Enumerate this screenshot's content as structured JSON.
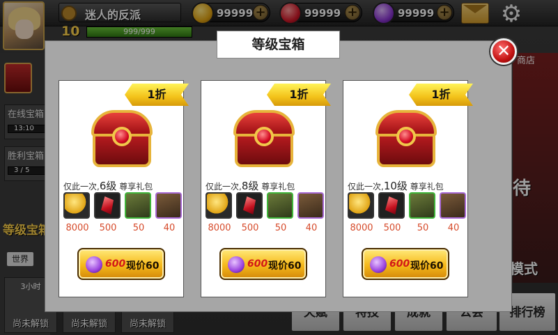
{
  "player": {
    "name": "迷人的反派",
    "level": "10",
    "exp_text": "999/999",
    "exp_fraction": 1.0
  },
  "currencies": [
    {
      "icon": "gold-coin-icon",
      "value": "99999"
    },
    {
      "icon": "ruby-gem-icon",
      "value": "99999"
    },
    {
      "icon": "purple-gem-icon",
      "value": "99999"
    }
  ],
  "background": {
    "side_labels": [
      "在线宝箱",
      "胜利宝箱"
    ],
    "side_progress": [
      "13:10",
      "3 / 5"
    ],
    "side_chest_label": "等级宝箱",
    "world_tab": "世界",
    "lock_time": "3小时",
    "lock_label": "尚未解锁",
    "shop": "商店",
    "wait": "待",
    "mode": "模式",
    "bottom_tabs": [
      "天赋",
      "特技",
      "成就",
      "公会",
      "排行榜"
    ]
  },
  "dialog": {
    "title": "等级宝箱",
    "cards": [
      {
        "discount": "1折",
        "offer_prefix": "仅此一次,",
        "level": "6级",
        "offer_suffix": "尊享礼包",
        "amounts": [
          "8000",
          "500",
          "50",
          "40"
        ],
        "old_price": "600",
        "now_price": "现价60"
      },
      {
        "discount": "1折",
        "offer_prefix": "仅此一次,",
        "level": "8级",
        "offer_suffix": "尊享礼包",
        "amounts": [
          "8000",
          "500",
          "50",
          "40"
        ],
        "old_price": "600",
        "now_price": "现价60"
      },
      {
        "discount": "1折",
        "offer_prefix": "仅此一次,",
        "level": "10级",
        "offer_suffix": "尊享礼包",
        "amounts": [
          "8000",
          "500",
          "50",
          "40"
        ],
        "old_price": "600",
        "now_price": "现价60"
      }
    ]
  },
  "colors": {
    "accent_gold": "#f6b91a",
    "price_red": "#d21818",
    "amount_red": "#d64a2a"
  }
}
